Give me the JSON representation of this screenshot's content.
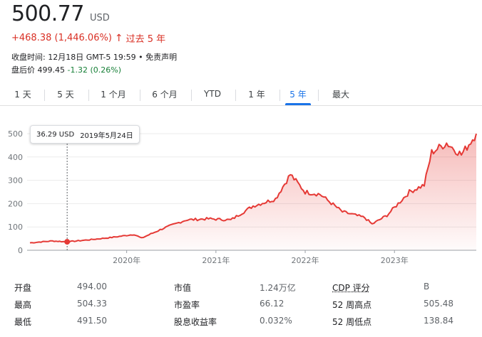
{
  "quote": {
    "price": "500.77",
    "currency": "USD",
    "change": "+468.38 (1,446.06%)",
    "change_arrow": "↑",
    "period_label": "过去 5 年",
    "meta": "收盘时间: 12月18日 GMT-5 19:59 •",
    "disclaimer": "免责声明",
    "after_hours_label": "盘后价",
    "after_hours_price": "499.45",
    "after_hours_delta": "-1.32 (0.26%)"
  },
  "tabs": [
    {
      "label": "1 天",
      "active": false
    },
    {
      "label": "5 天",
      "active": false
    },
    {
      "label": "1 个月",
      "active": false
    },
    {
      "label": "6 个月",
      "active": false
    },
    {
      "label": "YTD",
      "active": false
    },
    {
      "label": "1 年",
      "active": false
    },
    {
      "label": "5 年",
      "active": true
    },
    {
      "label": "最大",
      "active": false
    }
  ],
  "tooltip": {
    "price": "36.29 USD",
    "date": "2019年5月24日"
  },
  "chart_data": {
    "type": "area",
    "ylim": [
      0,
      500
    ],
    "yticks": [
      "0",
      "100",
      "200",
      "300",
      "400",
      "500"
    ],
    "xticks": [
      "2020年",
      "2021年",
      "2022年",
      "2023年"
    ],
    "series": [
      {
        "x": [
          "2018-12",
          "2019-03",
          "2019-05",
          "2019-08",
          "2019-11",
          "2020-02",
          "2020-03",
          "2020-06",
          "2020-09",
          "2020-12",
          "2021-03",
          "2021-06",
          "2021-09",
          "2021-11",
          "2022-01",
          "2022-03",
          "2022-06",
          "2022-09",
          "2022-10",
          "2022-12",
          "2023-03",
          "2023-05",
          "2023-06",
          "2023-08",
          "2023-10",
          "2023-12"
        ],
        "values": [
          32,
          40,
          36,
          45,
          55,
          68,
          52,
          95,
          130,
          135,
          130,
          190,
          220,
          325,
          250,
          240,
          165,
          140,
          112,
          150,
          250,
          280,
          420,
          460,
          410,
          500
        ]
      }
    ],
    "highlight": {
      "x": "2019-05",
      "value": 36.29
    },
    "line_color": "#e53935",
    "fill_color": "#e53935"
  },
  "stats": [
    {
      "label": "开盘",
      "value": "494.00"
    },
    {
      "label": "最高",
      "value": "504.33"
    },
    {
      "label": "最低",
      "value": "491.50"
    },
    {
      "label": "市值",
      "value": "1.24万亿"
    },
    {
      "label": "市盈率",
      "value": "66.12"
    },
    {
      "label": "股息收益率",
      "value": "0.032%"
    },
    {
      "label": "CDP 评分",
      "value": "B"
    },
    {
      "label": "52 周高点",
      "value": "505.48"
    },
    {
      "label": "52 周低点",
      "value": "138.84"
    }
  ]
}
